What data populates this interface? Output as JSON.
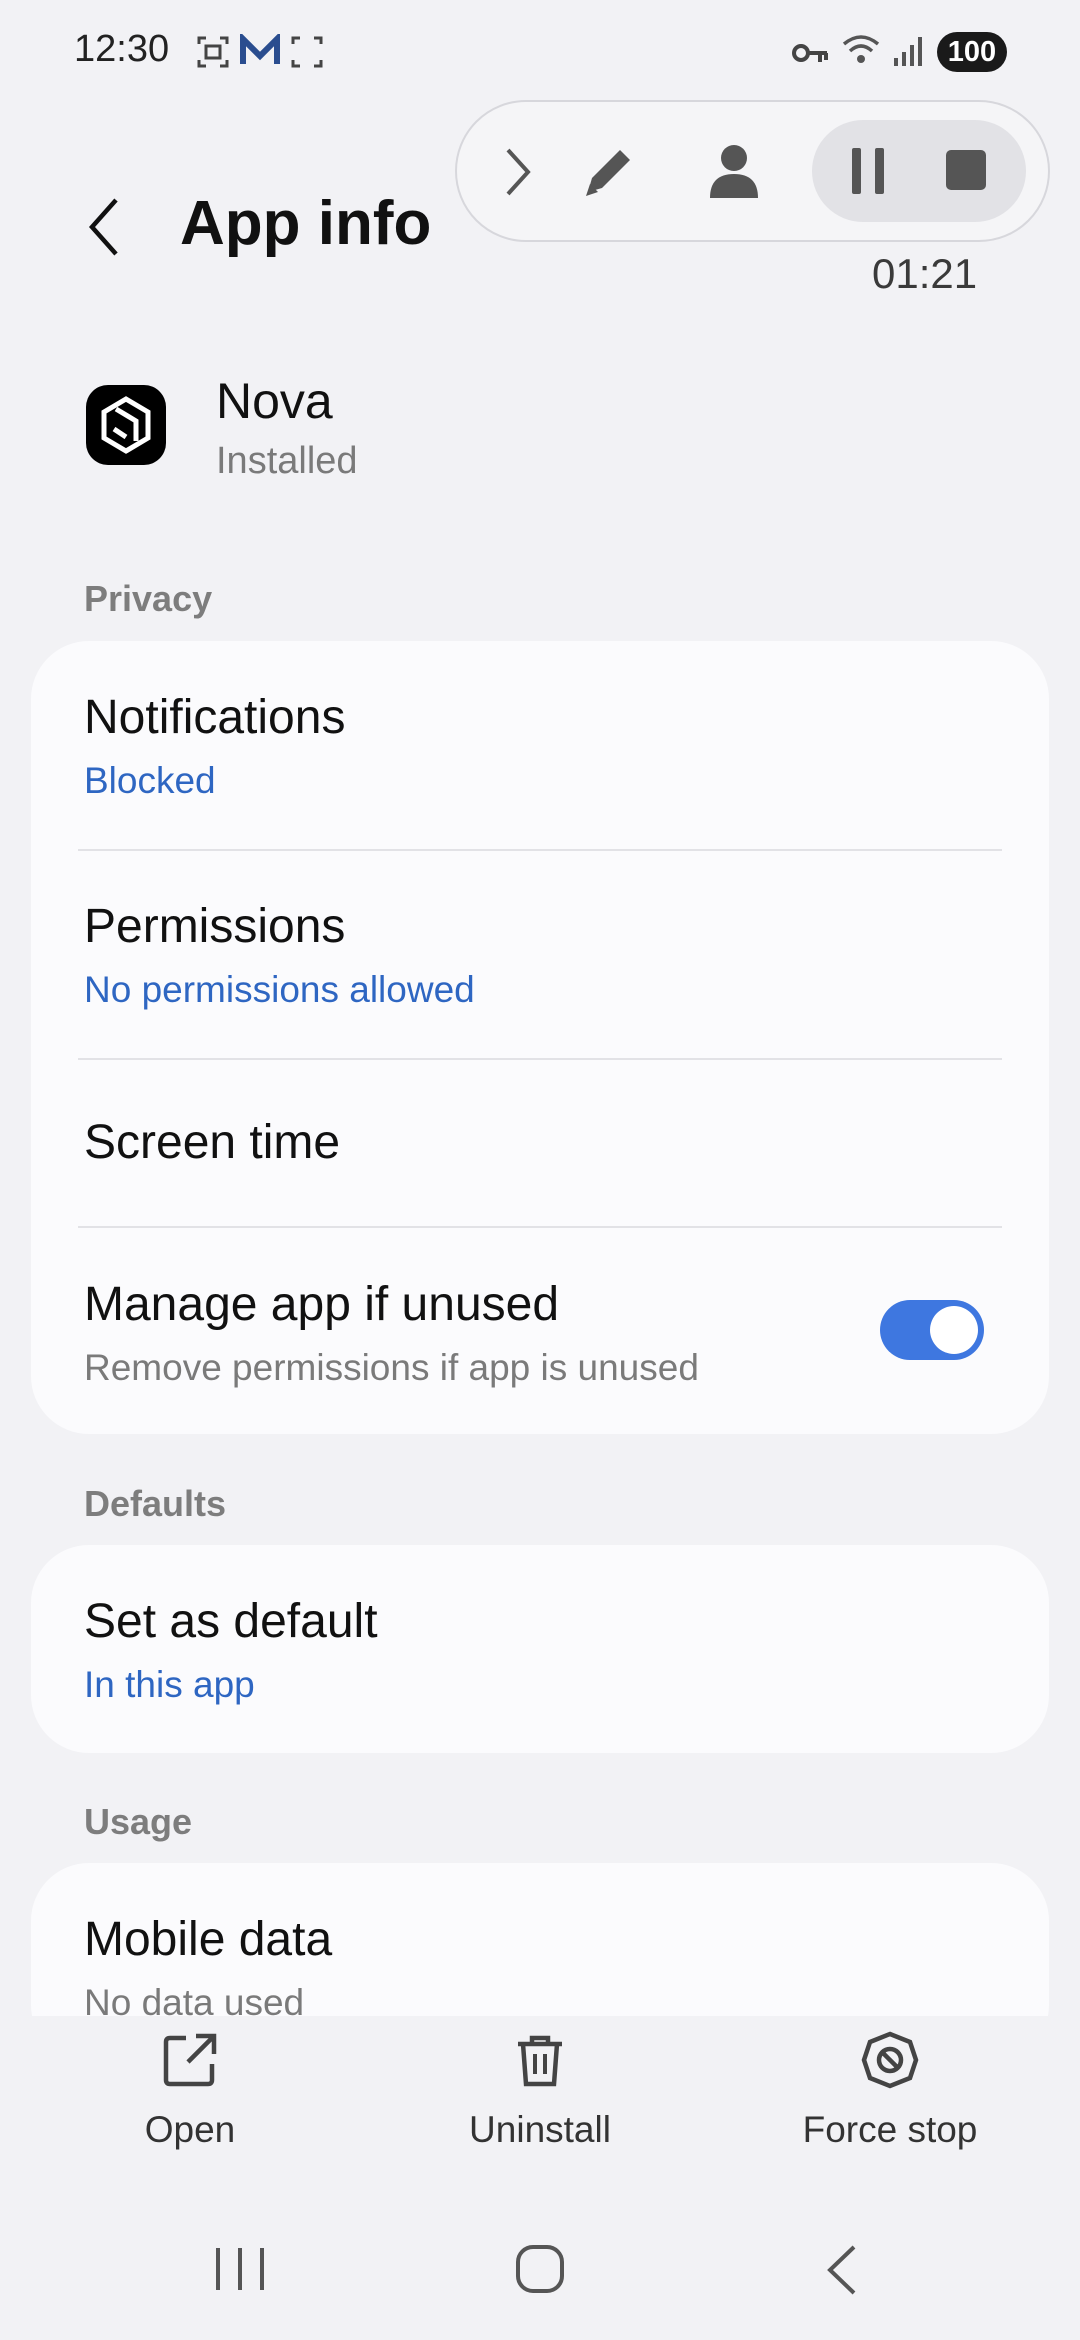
{
  "status_bar": {
    "time": "12:30",
    "battery": "100",
    "icons": [
      "screenshot-icon",
      "mail-icon",
      "scan-icon",
      "vpn-key-icon",
      "wifi-icon",
      "signal-icon"
    ]
  },
  "recorder": {
    "timer": "01:21",
    "icons": [
      "chevron-right-icon",
      "pencil-icon",
      "person-icon",
      "pause-icon",
      "stop-icon"
    ]
  },
  "header": {
    "title": "App info"
  },
  "app": {
    "name": "Nova",
    "status": "Installed"
  },
  "privacy": {
    "label": "Privacy",
    "notifications_title": "Notifications",
    "notifications_value": "Blocked",
    "permissions_title": "Permissions",
    "permissions_value": "No permissions allowed",
    "screen_time_title": "Screen time",
    "manage_unused_title": "Manage app if unused",
    "manage_unused_sub": "Remove permissions if app is unused",
    "manage_unused_on": true
  },
  "defaults": {
    "label": "Defaults",
    "set_default_title": "Set as default",
    "set_default_value": "In this app"
  },
  "usage": {
    "label": "Usage",
    "mobile_data_title": "Mobile data",
    "mobile_data_value": "No data used"
  },
  "actions": {
    "open": "Open",
    "uninstall": "Uninstall",
    "force_stop": "Force stop"
  },
  "colors": {
    "accent": "#2e66c2",
    "toggle": "#3e77e0",
    "background": "#f2f2f5",
    "card": "#fbfbfd"
  }
}
